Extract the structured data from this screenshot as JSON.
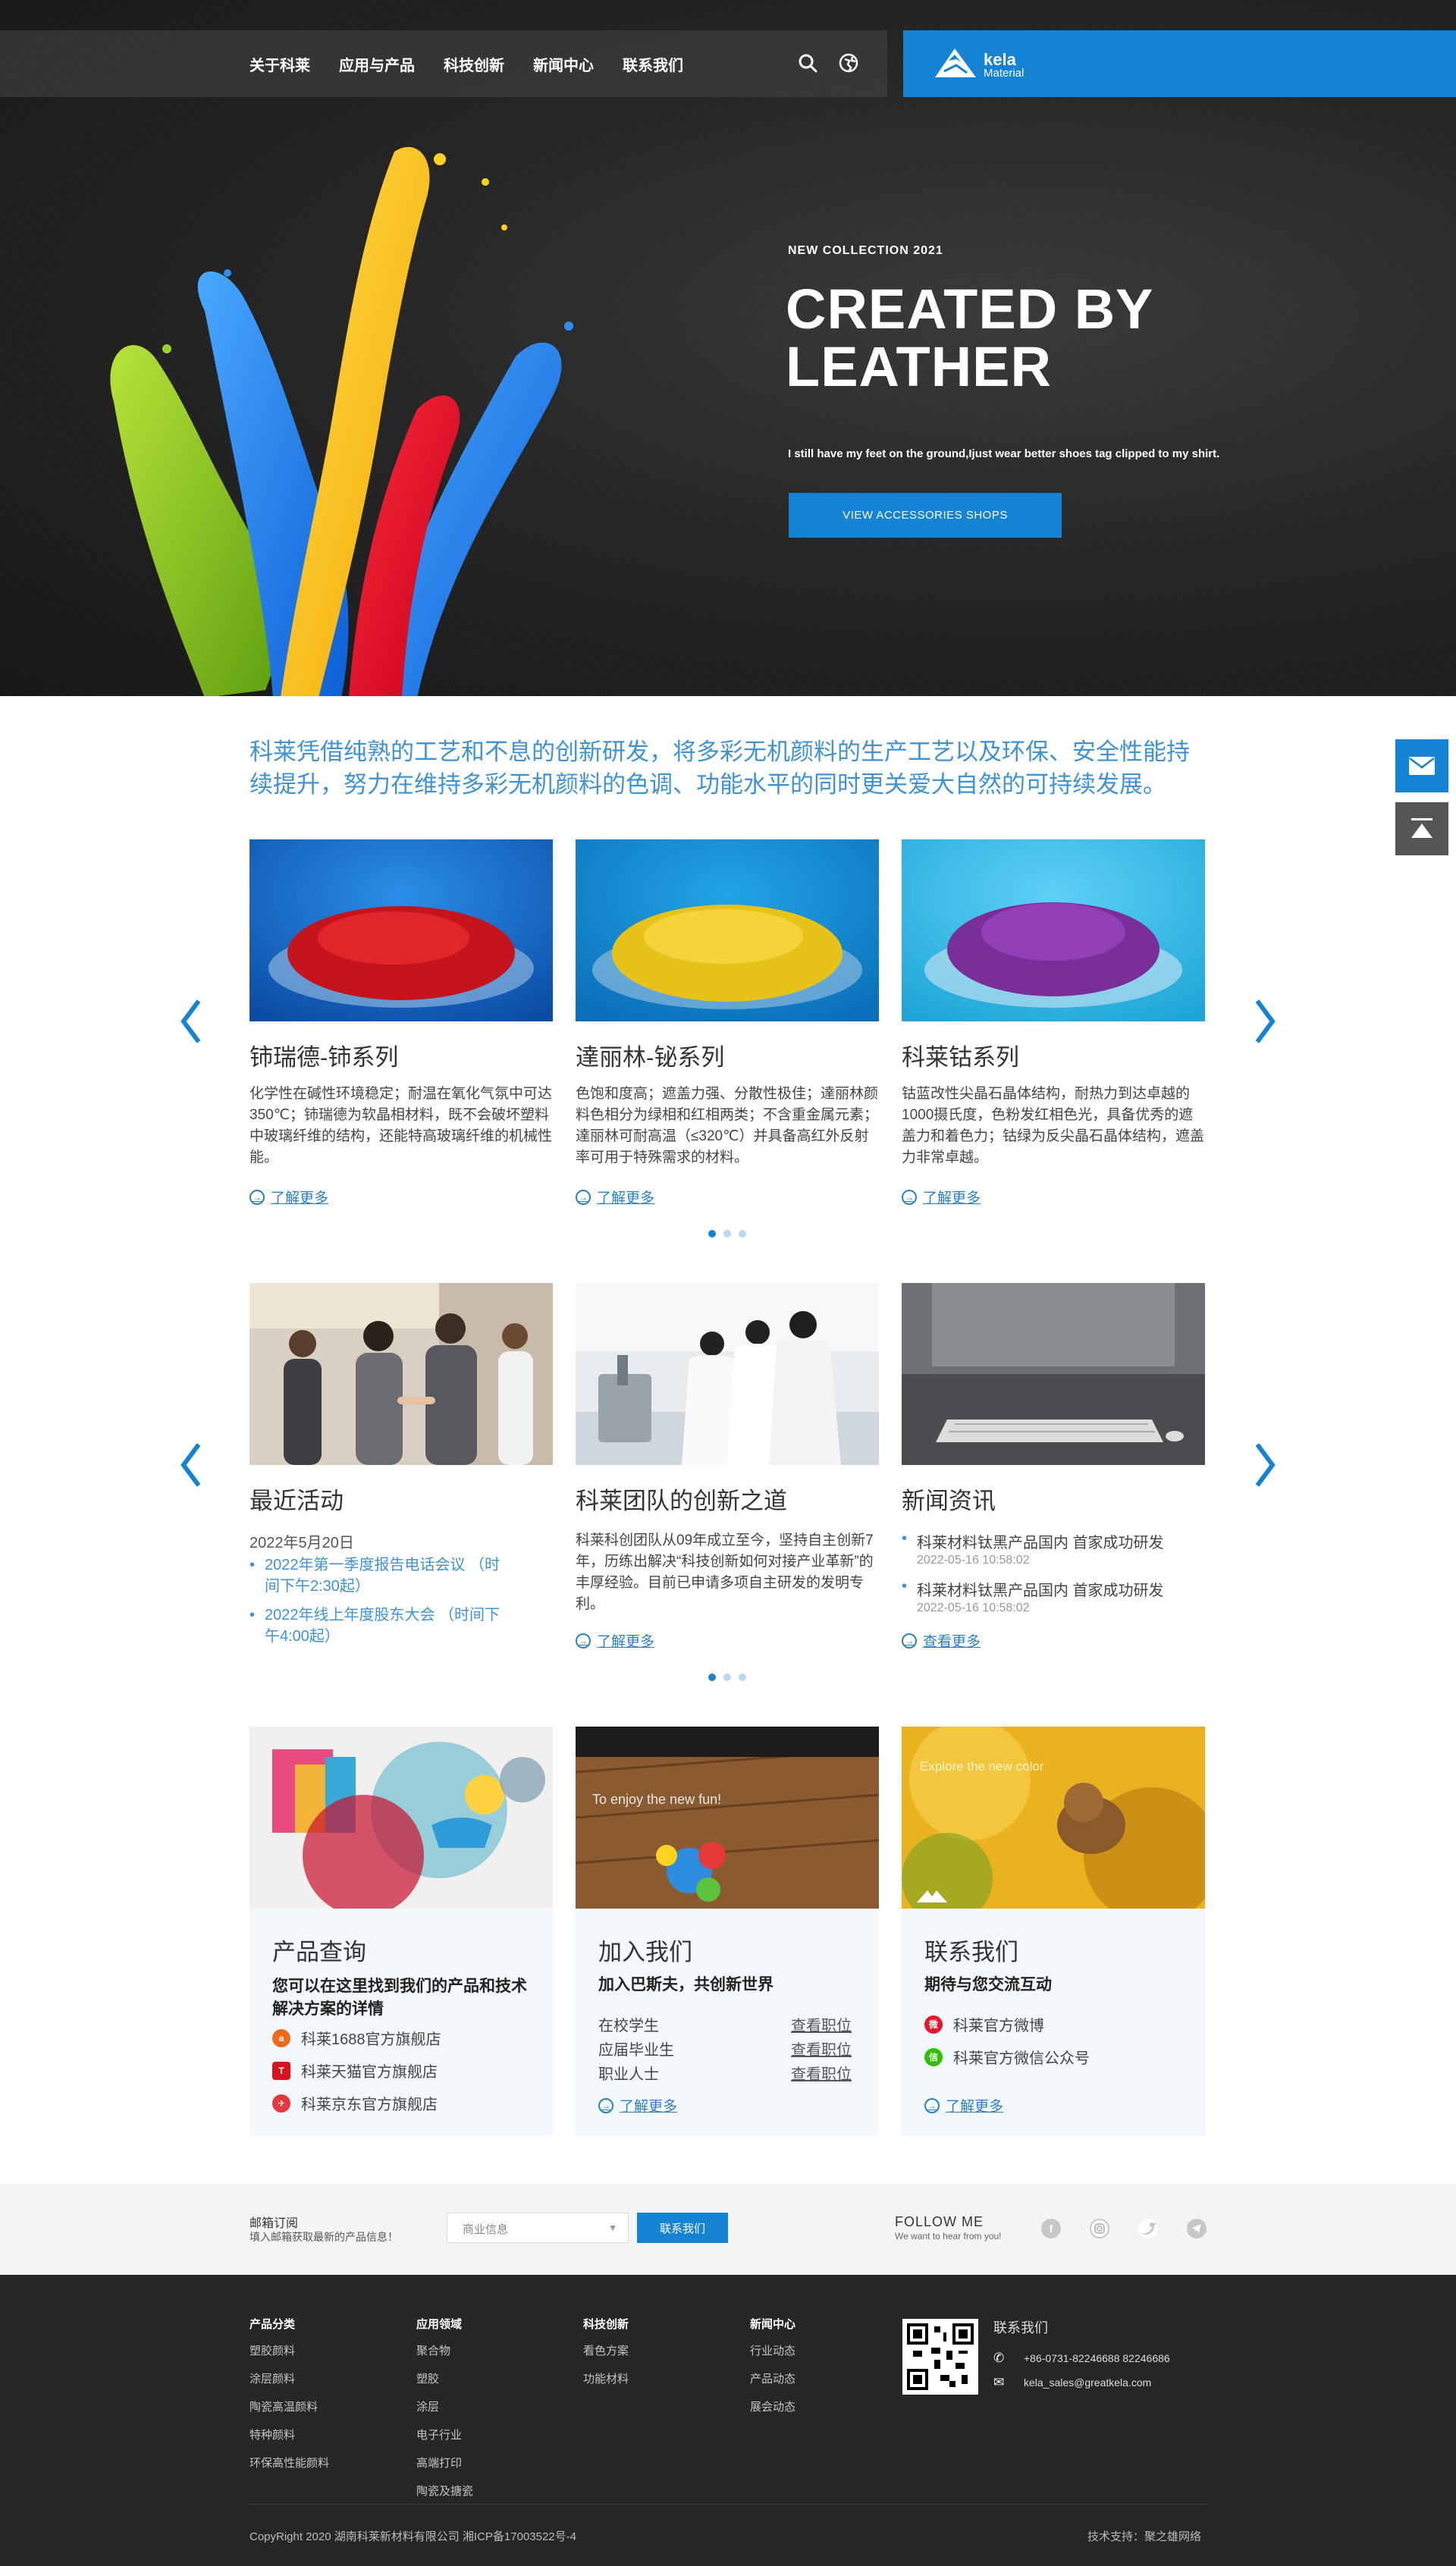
{
  "header": {
    "nav": [
      "关于科莱",
      "应用与产品",
      "科技创新",
      "新闻中心",
      "联系我们"
    ],
    "icons": [
      "search-icon",
      "globe-icon"
    ],
    "logo": {
      "name": "kela",
      "sub": "Material"
    }
  },
  "hero": {
    "kicker": "NEW COLLECTION 2021",
    "title": "CREATED BY LEATHER",
    "subtitle": "I still have my feet on the ground,Ijust wear better shoes tag clipped to my shirt.",
    "button": "VIEW ACCESSORIES SHOPS"
  },
  "intro": "科莱凭借纯熟的工艺和不息的创新研发，将多彩无机颜料的生产工艺以及环保、安全性能持续提升，努力在维持多彩无机颜料的色调、功能水平的同时更关爱大自然的可持续发展。",
  "products": [
    {
      "title": "铈瑞德-铈系列",
      "text": "化学性在碱性环境稳定；耐温在氧化气氛中可达350℃；铈瑞德为软晶相材料，既不会破坏塑料中玻璃纤维的结构，还能特高玻璃纤维的机械性能。",
      "more": "了解更多",
      "color": "#c5141c"
    },
    {
      "title": "達丽林-铋系列",
      "text": "色饱和度高；遮盖力强、分散性极佳；達丽林颜料色相分为绿相和红相两类；不含重金属元素； 達丽林可耐高温（≤320℃）并具备高红外反射率可用于特殊需求的材料。",
      "more": "了解更多",
      "color": "#e7c219"
    },
    {
      "title": "科莱钴系列",
      "text": "钴蓝改性尖晶石晶体结构，耐热力到达卓越的1000摄氏度，色粉发红相色光，具备优秀的遮盖力和着色力；钴绿为反尖晶石晶体结构，遮盖力非常卓越。",
      "more": "了解更多",
      "color": "#7a2e9a"
    }
  ],
  "news": {
    "events": {
      "title": "最近活动",
      "date": "2022年5月20日",
      "items": [
        "2022年第一季度报告电话会议 （时间下午2:30起）",
        "2022年线上年度股东大会 （时间下午4:00起）"
      ]
    },
    "team": {
      "title": "科莱团队的创新之道",
      "text": "科莱科创团队从09年成立至今，坚持自主创新7年，历练出解决“科技创新如何对接产业革新”的丰厚经验。目前已申请多项自主研发的发明专利。",
      "more": "了解更多"
    },
    "info": {
      "title": "新闻资讯",
      "items": [
        {
          "text": "科莱材料钛黑产品国内 首家成功研发",
          "date": "2022-05-16 10:58:02"
        },
        {
          "text": "科莱材料钛黑产品国内 首家成功研发",
          "date": "2022-05-16 10:58:02"
        }
      ],
      "more": "查看更多"
    }
  },
  "boxes": {
    "query": {
      "title": "产品查询",
      "lead": "您可以在这里找到我们的产品和技术解决方案的详情",
      "shops": [
        {
          "label": "科莱1688官方旗舰店",
          "icon": "1688-icon",
          "color": "#f06a1d"
        },
        {
          "label": "科莱天猫官方旗舰店",
          "icon": "tmall-icon",
          "color": "#d7141e"
        },
        {
          "label": "科莱京东官方旗舰店",
          "icon": "jd-icon",
          "color": "#e4393c"
        }
      ]
    },
    "join": {
      "title": "加入我们",
      "lead": "加入巴斯夫，共创新世界",
      "image_text": "To enjoy the new fun!",
      "jobs": [
        {
          "label": "在校学生",
          "link": "查看职位"
        },
        {
          "label": "应届毕业生",
          "link": "查看职位"
        },
        {
          "label": "职业人士",
          "link": "查看职位"
        }
      ],
      "more": "了解更多"
    },
    "contact": {
      "title": "联系我们",
      "lead": "期待与您交流互动",
      "image_text": "Explore the new color",
      "items": [
        {
          "label": "科莱官方微博",
          "icon": "weibo-icon",
          "color": "#e6162d"
        },
        {
          "label": "科莱官方微信公众号",
          "icon": "wechat-icon",
          "color": "#2dc100"
        }
      ],
      "more": "了解更多"
    }
  },
  "subscribe": {
    "title": "邮箱订阅",
    "subtitle": "填入邮箱获取最新的产品信息！",
    "select": "商业信息",
    "button": "联系我们",
    "follow_title": "FOLLOW ME",
    "follow_sub": "We want to hear from you!",
    "social": [
      "facebook-icon",
      "instagram-icon",
      "twitter-icon",
      "telegram-icon"
    ]
  },
  "footer": {
    "columns": [
      {
        "title": "产品分类",
        "links": [
          "塑胶颜料",
          "涂层颜料",
          "陶瓷高温颜料",
          "特种颜料",
          "环保高性能颜料"
        ]
      },
      {
        "title": "应用领域",
        "links": [
          "聚合物",
          "塑胶",
          "涂层",
          "电子行业",
          "高端打印",
          "陶瓷及搪瓷"
        ]
      },
      {
        "title": "科技创新",
        "links": [
          "看色方案",
          "功能材料"
        ]
      },
      {
        "title": "新闻中心",
        "links": [
          "行业动态",
          "产品动态",
          "展会动态"
        ]
      }
    ],
    "contact_title": "联系我们",
    "phone": "+86-0731-82246688  82246686",
    "email": "kela_sales@greatkela.com",
    "copyright": "CopyRight 2020 湖南科莱新材料有限公司 湘ICP备17003522号-4",
    "credit": "技术支持：聚之雄网络"
  },
  "colors": {
    "accent": "#1583d4",
    "intro_text": "#3f93d0",
    "footer_bg": "#262626"
  }
}
